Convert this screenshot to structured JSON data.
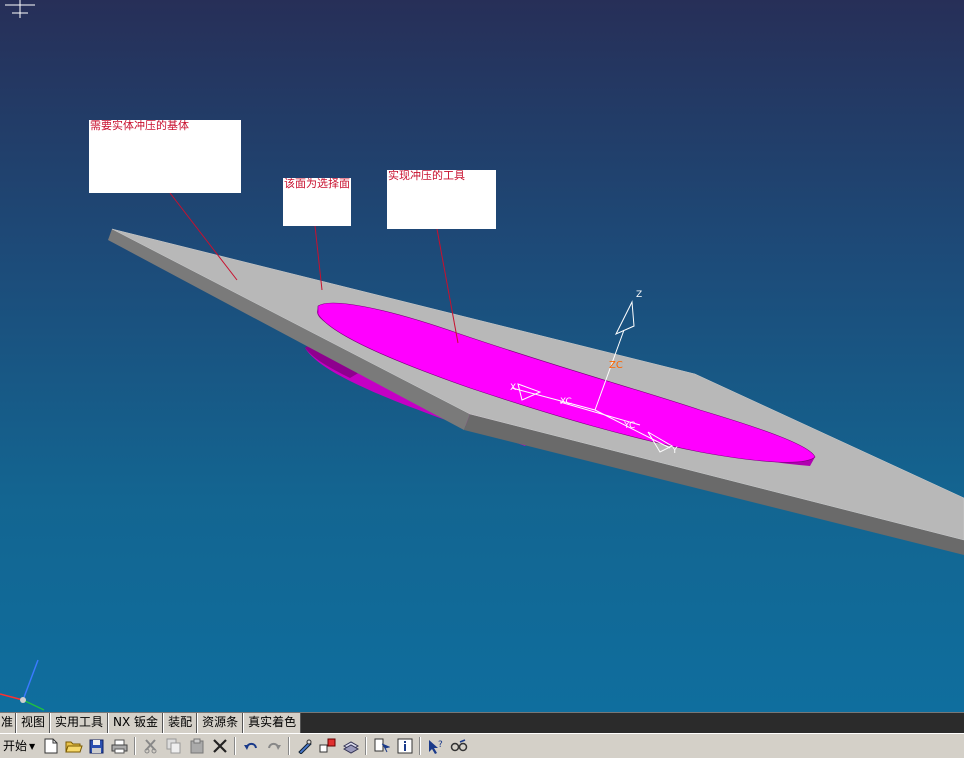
{
  "annotations": {
    "base_body": "需要实体冲压的基体",
    "selected_face": "该面为选择面",
    "stamp_tool": "实现冲压的工具"
  },
  "csys": {
    "z": "Z",
    "zc": "ZC",
    "x": "X",
    "xc": "XC",
    "y": "Y",
    "yc": "YC"
  },
  "tabs": [
    {
      "label": "准"
    },
    {
      "label": "视图"
    },
    {
      "label": "实用工具"
    },
    {
      "label": "NX 钣金"
    },
    {
      "label": "装配"
    },
    {
      "label": "资源条"
    },
    {
      "label": "真实着色"
    }
  ],
  "toolbar": {
    "start_label": "开始",
    "icons": [
      "new-file-icon",
      "open-folder-icon",
      "save-icon",
      "print-icon",
      "cut-icon",
      "copy-icon",
      "paste-icon",
      "delete-icon",
      "undo-icon",
      "redo-icon",
      "edit-object-icon",
      "transform-icon",
      "layer-icon",
      "info-pointer-icon",
      "info-icon",
      "help-pointer-icon",
      "glasses-icon"
    ]
  },
  "colors": {
    "sheet": "#b7b7b7",
    "tool": "#ff00ff",
    "annotation_text": "#c8102e",
    "wcs_orange": "#ff6600"
  }
}
